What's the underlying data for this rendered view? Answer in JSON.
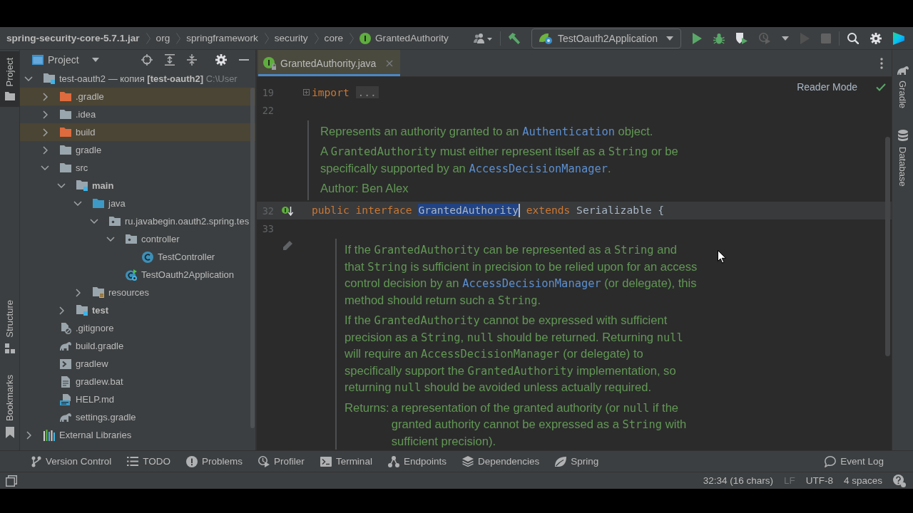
{
  "navbar": {
    "breadcrumbs": [
      {
        "label": "spring-security-core-5.7.1.jar",
        "kind": "jar"
      },
      {
        "label": "org",
        "kind": "package"
      },
      {
        "label": "springframework",
        "kind": "package"
      },
      {
        "label": "security",
        "kind": "package"
      },
      {
        "label": "core",
        "kind": "package"
      },
      {
        "label": "GrantedAuthority",
        "kind": "interface"
      }
    ],
    "toolbar": [
      {
        "kind": "users",
        "disabled": false
      },
      {
        "kind": "build",
        "disabled": false
      },
      {
        "kind": "run-config",
        "label": "TestOauth2Application",
        "disabled": false
      },
      {
        "kind": "run",
        "disabled": false
      },
      {
        "kind": "debug",
        "disabled": false
      },
      {
        "kind": "coverage",
        "disabled": false
      },
      {
        "kind": "profile",
        "disabled": true
      },
      {
        "kind": "more",
        "disabled": false
      },
      {
        "kind": "rerun",
        "disabled": true
      },
      {
        "kind": "stop",
        "disabled": true
      },
      {
        "kind": "search",
        "disabled": false
      },
      {
        "kind": "settings",
        "disabled": false
      },
      {
        "kind": "toolbox",
        "disabled": false
      }
    ]
  },
  "left_stripe": {
    "top": [
      {
        "label": "Project",
        "kind": "project",
        "selected": true
      }
    ],
    "bottom": [
      {
        "label": "Structure",
        "kind": "structure",
        "selected": false
      },
      {
        "label": "Bookmarks",
        "kind": "bookmarks",
        "selected": false
      }
    ]
  },
  "project": {
    "title": "Project",
    "tree": [
      {
        "label": "test-oauth2 — копия **[test-oauth2]**",
        "location": "C:\\User",
        "kind": "module",
        "expanded": true,
        "children": [
          {
            "label": ".gradle",
            "kind": "excluded-folder",
            "expanded": false
          },
          {
            "label": ".idea",
            "kind": "folder",
            "expanded": false
          },
          {
            "label": "build",
            "kind": "excluded-folder",
            "expanded": false
          },
          {
            "label": "gradle",
            "kind": "folder",
            "expanded": false
          },
          {
            "label": "src",
            "kind": "folder",
            "expanded": true,
            "children": [
              {
                "label": "main",
                "kind": "source-set",
                "expanded": true,
                "children": [
                  {
                    "label": "java",
                    "kind": "java-root",
                    "expanded": true,
                    "children": [
                      {
                        "label": "ru.javabegin.oauth2.spring.tes",
                        "kind": "package",
                        "expanded": true,
                        "children": [
                          {
                            "label": "controller",
                            "kind": "package",
                            "expanded": true,
                            "children": [
                              {
                                "label": "TestController",
                                "kind": "class"
                              }
                            ]
                          },
                          {
                            "label": "TestOauth2Application",
                            "kind": "spring-app"
                          }
                        ]
                      }
                    ]
                  },
                  {
                    "label": "resources",
                    "kind": "resources-root",
                    "expanded": false
                  }
                ]
              },
              {
                "label": "test",
                "kind": "source-set",
                "expanded": false
              }
            ]
          },
          {
            "label": ".gitignore",
            "kind": "ignore-file"
          },
          {
            "label": "build.gradle",
            "kind": "gradle-script"
          },
          {
            "label": "gradlew",
            "kind": "shell-script"
          },
          {
            "label": "gradlew.bat",
            "kind": "batch-file"
          },
          {
            "label": "HELP.md",
            "kind": "markdown"
          },
          {
            "label": "settings.gradle",
            "kind": "gradle-script"
          }
        ]
      },
      {
        "label": "External Libraries",
        "kind": "libraries",
        "expanded": false
      }
    ]
  },
  "editor": {
    "tabs": [
      {
        "label": "GrantedAuthority.java",
        "kind": "interface",
        "read_only": true,
        "selected": true
      }
    ],
    "reader_mode": "Reader Mode",
    "lines": [
      {
        "kind": "code",
        "number": "19",
        "current": false,
        "tokens": [
          {
            "kind": "keyword",
            "text": "import"
          },
          {
            "kind": "folded",
            "text": "..."
          }
        ]
      },
      {
        "kind": "code",
        "number": "22",
        "current": false
      },
      {
        "kind": "class-doc",
        "paragraphs": [
          [
            {
              "kind": "text",
              "text": "Represents an authority granted to an "
            },
            {
              "kind": "link",
              "text": "Authentication"
            },
            {
              "kind": "text",
              "text": " object."
            }
          ],
          [
            {
              "kind": "text",
              "text": "A "
            },
            {
              "kind": "code",
              "text": "GrantedAuthority"
            },
            {
              "kind": "text",
              "text": " must either represent itself as a "
            },
            {
              "kind": "code",
              "text": "String"
            },
            {
              "kind": "text",
              "text": " or be specifically supported by an "
            },
            {
              "kind": "link",
              "text": "AccessDecisionManager"
            },
            {
              "kind": "text",
              "text": "."
            }
          ],
          [
            {
              "kind": "text",
              "text": "Author: Ben Alex"
            }
          ]
        ]
      },
      {
        "kind": "code",
        "number": "32",
        "current": true,
        "gutter": {
          "kind": "implemented"
        },
        "tokens": [
          {
            "kind": "keyword",
            "text": "public"
          },
          {
            "kind": "keyword",
            "text": "interface"
          },
          {
            "kind": "selection",
            "text": "GrantedAuthority"
          },
          {
            "kind": "caret"
          },
          {
            "kind": "keyword",
            "text": "extends"
          },
          {
            "kind": "type",
            "text": "Serializable"
          },
          {
            "kind": "plain",
            "text": "{"
          }
        ]
      },
      {
        "kind": "code",
        "number": "33",
        "current": false
      },
      {
        "kind": "member-doc",
        "gutter": {
          "kind": "edit"
        },
        "paragraphs": [
          [
            {
              "kind": "text",
              "text": "If the "
            },
            {
              "kind": "code",
              "text": "GrantedAuthority"
            },
            {
              "kind": "text",
              "text": " can be represented as a "
            },
            {
              "kind": "code",
              "text": "String"
            },
            {
              "kind": "text",
              "text": " and that "
            },
            {
              "kind": "code",
              "text": "String"
            },
            {
              "kind": "text",
              "text": " is sufficient in precision to be relied upon for an access control decision by an "
            },
            {
              "kind": "link",
              "text": "AccessDecisionManager"
            },
            {
              "kind": "text",
              "text": " (or delegate), this method should return such a "
            },
            {
              "kind": "code",
              "text": "String"
            },
            {
              "kind": "text",
              "text": "."
            }
          ],
          [
            {
              "kind": "text",
              "text": "If the "
            },
            {
              "kind": "code",
              "text": "GrantedAuthority"
            },
            {
              "kind": "text",
              "text": " cannot be expressed with sufficient precision as a "
            },
            {
              "kind": "code",
              "text": "String"
            },
            {
              "kind": "text",
              "text": ", "
            },
            {
              "kind": "code",
              "text": "null"
            },
            {
              "kind": "text",
              "text": " should be returned. Returning "
            },
            {
              "kind": "code",
              "text": "null"
            },
            {
              "kind": "text",
              "text": " will require an "
            },
            {
              "kind": "code",
              "text": "AccessDecisionManager"
            },
            {
              "kind": "text",
              "text": " (or delegate) to specifically support the "
            },
            {
              "kind": "code",
              "text": "GrantedAuthority"
            },
            {
              "kind": "text",
              "text": " implementation, so returning "
            },
            {
              "kind": "code",
              "text": "null"
            },
            {
              "kind": "text",
              "text": " should be avoided unless actually required."
            }
          ]
        ],
        "returns": {
          "label": "Returns:",
          "segments": [
            {
              "kind": "text",
              "text": "a representation of the granted authority (or "
            },
            {
              "kind": "code",
              "text": "null"
            },
            {
              "kind": "text",
              "text": " if the granted authority cannot be expressed as a "
            },
            {
              "kind": "code",
              "text": "String"
            },
            {
              "kind": "text",
              "text": " with sufficient precision)."
            }
          ]
        }
      }
    ]
  },
  "right_stripe": {
    "tabs": [
      {
        "label": "Gradle",
        "kind": "gradle",
        "selected": false
      },
      {
        "label": "Database",
        "kind": "database",
        "selected": false
      }
    ]
  },
  "tool_window_bar": {
    "tabs": [
      {
        "label": "Version Control",
        "kind": "vcs",
        "selected": false
      },
      {
        "label": "TODO",
        "kind": "todo",
        "selected": false
      },
      {
        "label": "Problems",
        "kind": "problems",
        "selected": false
      },
      {
        "label": "Profiler",
        "kind": "profiler",
        "selected": false
      },
      {
        "label": "Terminal",
        "kind": "terminal",
        "selected": false
      },
      {
        "label": "Endpoints",
        "kind": "endpoints",
        "selected": false
      },
      {
        "label": "Dependencies",
        "kind": "dependencies",
        "selected": false
      },
      {
        "label": "Spring",
        "kind": "spring",
        "selected": false
      }
    ],
    "right": [
      {
        "label": "Event Log",
        "kind": "event-log",
        "selected": false
      }
    ]
  },
  "status_bar": {
    "items": [
      {
        "text": "32:34 (16 chars)",
        "disabled": false
      },
      {
        "text": "LF",
        "disabled": true
      },
      {
        "text": "UTF-8",
        "disabled": false
      },
      {
        "text": "4 spaces",
        "disabled": false
      }
    ]
  }
}
